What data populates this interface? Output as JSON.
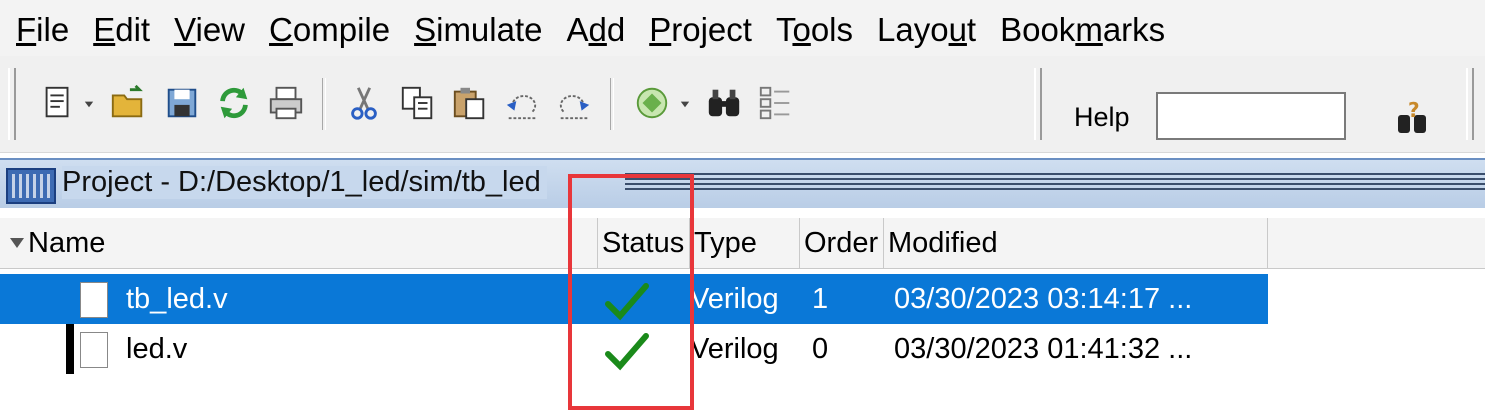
{
  "menu": [
    {
      "label": "File",
      "mnemonic_index": 0
    },
    {
      "label": "Edit",
      "mnemonic_index": 0
    },
    {
      "label": "View",
      "mnemonic_index": 0
    },
    {
      "label": "Compile",
      "mnemonic_index": 0
    },
    {
      "label": "Simulate",
      "mnemonic_index": 0
    },
    {
      "label": "Add",
      "mnemonic_index": 1
    },
    {
      "label": "Project",
      "mnemonic_index": 0
    },
    {
      "label": "Tools",
      "mnemonic_index": 1
    },
    {
      "label": "Layout",
      "mnemonic_index": 4
    },
    {
      "label": "Bookmarks",
      "mnemonic_index": 4
    }
  ],
  "toolbar": {
    "icons": [
      "new-file-icon",
      "open-folder-icon",
      "save-icon",
      "refresh-icon",
      "print-icon",
      "cut-icon",
      "copy-icon",
      "paste-icon",
      "undo-icon",
      "redo-icon",
      "compile-icon",
      "find-icon",
      "format-icon"
    ],
    "help_label": "Help",
    "help_value": "",
    "help_search_icon": "help-search-icon"
  },
  "project": {
    "title": "Project - D:/Desktop/1_led/sim/tb_led"
  },
  "columns": [
    "Name",
    "Status",
    "Type",
    "Order",
    "Modified"
  ],
  "rows": [
    {
      "name": "tb_led.v",
      "status": "check",
      "type": "Verilog",
      "order": "1",
      "modified": "03/30/2023 03:14:17 ...",
      "selected": true
    },
    {
      "name": "led.v",
      "status": "check",
      "type": "Verilog",
      "order": "0",
      "modified": "03/30/2023 01:41:32 ...",
      "selected": false
    }
  ],
  "colors": {
    "selection": "#0a78d7",
    "check": "#1a8a1a",
    "highlight_box": "#e8363a"
  }
}
